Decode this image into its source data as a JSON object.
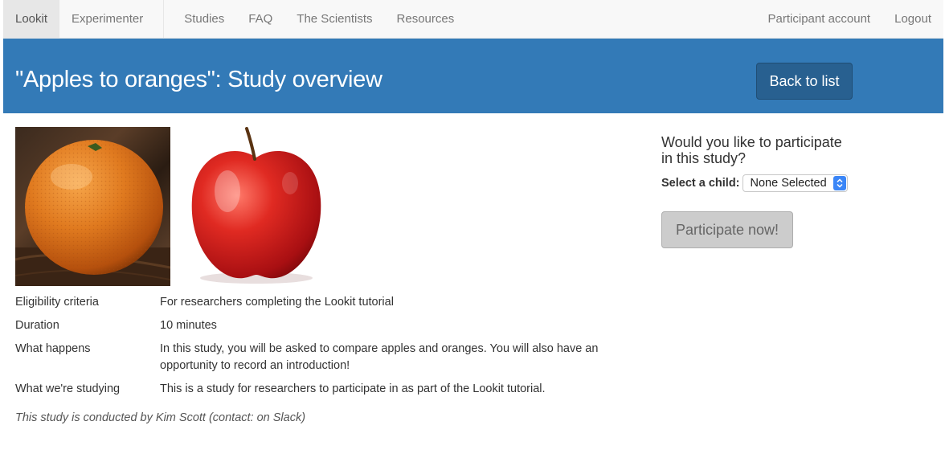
{
  "nav": {
    "brand": "Lookit",
    "experimenter": "Experimenter",
    "items": [
      "Studies",
      "FAQ",
      "The Scientists",
      "Resources"
    ],
    "account": "Participant account",
    "logout": "Logout"
  },
  "header": {
    "title": "\"Apples to oranges\": Study overview",
    "back_label": "Back to list"
  },
  "details": [
    {
      "label": "Eligibility criteria",
      "value": "For researchers completing the Lookit tutorial"
    },
    {
      "label": "Duration",
      "value": "10 minutes"
    },
    {
      "label": "What happens",
      "value": "In this study, you will be asked to compare apples and oranges. You will also have an opportunity to record an introduction!"
    },
    {
      "label": "What we're studying",
      "value": "This is a study for researchers to participate in as part of the Lookit tutorial."
    }
  ],
  "conducted_by": "This study is conducted by Kim Scott (contact: on Slack)",
  "participate": {
    "question": "Would you like to participate in this study?",
    "select_label": "Select a child:",
    "select_value": "None Selected",
    "button_label": "Participate now!"
  },
  "colors": {
    "header_bg": "#337ab7",
    "back_button_bg": "#286090",
    "disabled_button_bg": "#cccccc"
  }
}
